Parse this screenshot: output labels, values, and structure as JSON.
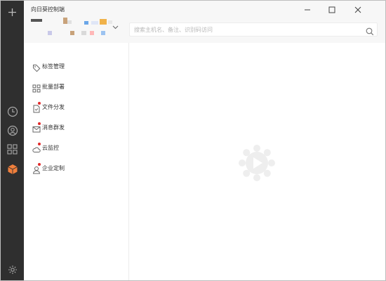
{
  "app": {
    "title": "向日葵控制端"
  },
  "account": {
    "blur_colors": [
      "#5a5a5a",
      "#c8a27a",
      "#d9d9d9",
      "#6aa6e8",
      "#f0b24a",
      "#d7d7ff",
      "#c9c9e9",
      "#ffb8b8",
      "#9cc3f0",
      "#e0e0e0"
    ]
  },
  "search": {
    "placeholder": "搜索主机名、备注、识别码访问"
  },
  "rail": {
    "items": [
      {
        "name": "add",
        "icon": "plus-icon"
      },
      {
        "name": "history",
        "icon": "clock-icon"
      },
      {
        "name": "remote",
        "icon": "remote-device-icon"
      },
      {
        "name": "apps",
        "icon": "grid-apps-icon"
      },
      {
        "name": "solutions",
        "icon": "cube-icon",
        "active": true,
        "color": "#f07f3c"
      },
      {
        "name": "settings",
        "icon": "gear-icon"
      }
    ]
  },
  "menu": {
    "items": [
      {
        "label": "标签管理",
        "icon": "tag-icon",
        "badge": false
      },
      {
        "label": "批量部署",
        "icon": "batch-grid-icon",
        "badge": false
      },
      {
        "label": "文件分发",
        "icon": "file-icon",
        "badge": true
      },
      {
        "label": "消息群发",
        "icon": "mail-icon",
        "badge": true
      },
      {
        "label": "云监控",
        "icon": "cloud-icon",
        "badge": true
      },
      {
        "label": "企业定制",
        "icon": "user-icon",
        "badge": true
      }
    ]
  },
  "colors": {
    "accent": "#f07f3c",
    "rail": "#2f2f2f",
    "badge": "#e22b2b",
    "top_bg": "#f7f7f7"
  }
}
